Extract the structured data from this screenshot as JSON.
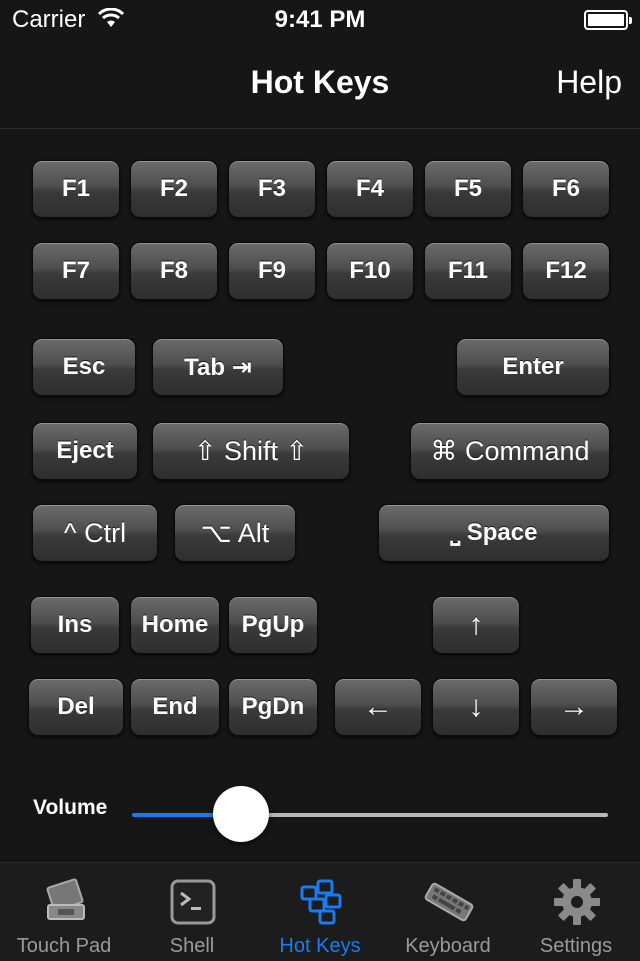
{
  "status_bar": {
    "carrier": "Carrier",
    "time": "9:41 PM"
  },
  "nav": {
    "title": "Hot Keys",
    "help": "Help"
  },
  "function_keys": [
    "F1",
    "F2",
    "F3",
    "F4",
    "F5",
    "F6",
    "F7",
    "F8",
    "F9",
    "F10",
    "F11",
    "F12"
  ],
  "keys": {
    "esc": "Esc",
    "tab": "Tab ⇥",
    "enter": "Enter",
    "eject": "Eject",
    "shift": "⇧ Shift ⇧",
    "command": "⌘ Command",
    "ctrl": "^ Ctrl",
    "alt": "⌥ Alt",
    "space": "⎵ Space",
    "ins": "Ins",
    "home": "Home",
    "pgup": "PgUp",
    "del": "Del",
    "end": "End",
    "pgdn": "PgDn",
    "up": "↑",
    "left": "←",
    "down": "↓",
    "right": "→"
  },
  "volume": {
    "label": "Volume",
    "level": 0.23
  },
  "tabs": [
    {
      "label": "Touch Pad",
      "icon": "laptop-icon"
    },
    {
      "label": "Shell",
      "icon": "terminal-icon"
    },
    {
      "label": "Hot Keys",
      "icon": "hotkeys-icon",
      "active": true
    },
    {
      "label": "Keyboard",
      "icon": "keyboard-icon"
    },
    {
      "label": "Settings",
      "icon": "gear-icon"
    }
  ],
  "colors": {
    "accent": "#1a7cf0",
    "background": "#161616",
    "inactive_tab": "#9a9a9a"
  }
}
